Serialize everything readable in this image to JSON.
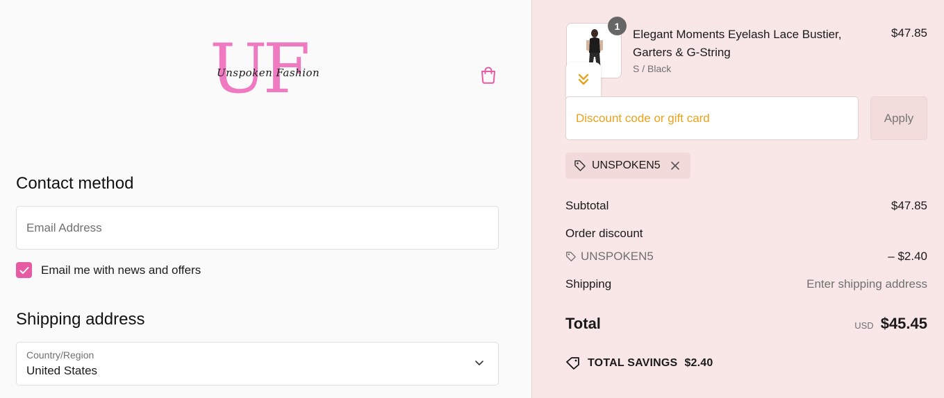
{
  "brand": {
    "logo_letters": "UF",
    "logo_script": "Unspoken Fashion",
    "accent_color": "#f07ac1"
  },
  "header": {
    "cart_icon": "shopping-bag-icon"
  },
  "contact": {
    "heading": "Contact method",
    "email_placeholder": "Email Address",
    "newsletter_label": "Email me with news and offers",
    "newsletter_checked": true
  },
  "shipping": {
    "heading": "Shipping address",
    "country_label": "Country/Region",
    "country_value": "United States"
  },
  "cart": {
    "item": {
      "name": "Elegant Moments Eyelash Lace Bustier, Garters & G-String",
      "variant": "S / Black",
      "price": "$47.85",
      "quantity": "1"
    },
    "discount_placeholder": "Discount code or gift card",
    "apply_label": "Apply",
    "applied_code": "UNSPOKEN5"
  },
  "summary": {
    "subtotal_label": "Subtotal",
    "subtotal_value": "$47.85",
    "order_discount_label": "Order discount",
    "discount_code": "UNSPOKEN5",
    "discount_value": "– $2.40",
    "shipping_label": "Shipping",
    "shipping_value": "Enter shipping address",
    "total_label": "Total",
    "currency": "USD",
    "total_value": "$45.45",
    "savings_label": "TOTAL SAVINGS",
    "savings_value": "$2.40"
  },
  "colors": {
    "checkbox": "#e75ba4",
    "discount_placeholder": "#e8a21b",
    "right_panel_bg": "#f9e6e6"
  }
}
